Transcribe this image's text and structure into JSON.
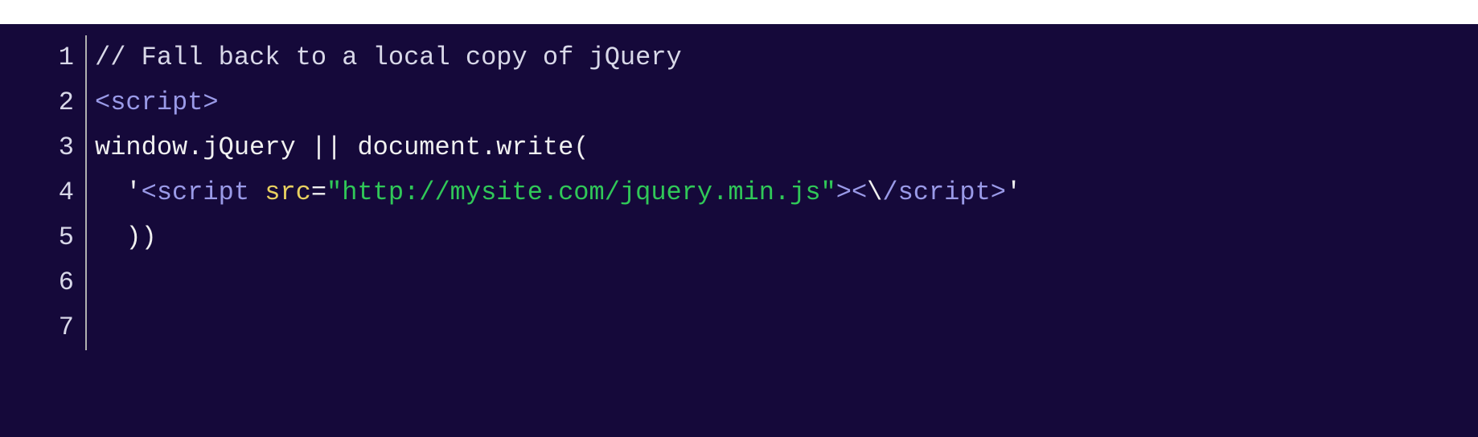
{
  "editor": {
    "lineNumbers": [
      "1",
      "2",
      "3",
      "4",
      "5",
      "6",
      "7"
    ],
    "line1": {
      "comment": "// Fall back to a local copy of jQuery"
    },
    "line2": {
      "lt1": "<",
      "tag": "script",
      "gt1": ">"
    },
    "line3": {
      "text": "window.jQuery || document.write("
    },
    "line4": {
      "indent": "  ",
      "quote1": "'",
      "lt1": "<",
      "tag1": "script",
      "space1": " ",
      "attr": "src",
      "eq": "=",
      "dq1": "\"",
      "url": "http://mysite.com/jquery.min.js",
      "dq2": "\"",
      "gt1": ">",
      "lt2": "<",
      "esc": "\\",
      "slash": "/",
      "tag2": "script",
      "gt2": ">",
      "quote2": "'"
    },
    "line5": {
      "text": "  ))"
    },
    "line6": {
      "text": ""
    },
    "line7": {
      "text": ""
    }
  },
  "colors": {
    "background": "#15093a",
    "comment": "#d8d8e8",
    "tag": "#9a9ae8",
    "plain": "#f0f0f0",
    "attribute": "#e8d060",
    "string": "#30c858"
  }
}
